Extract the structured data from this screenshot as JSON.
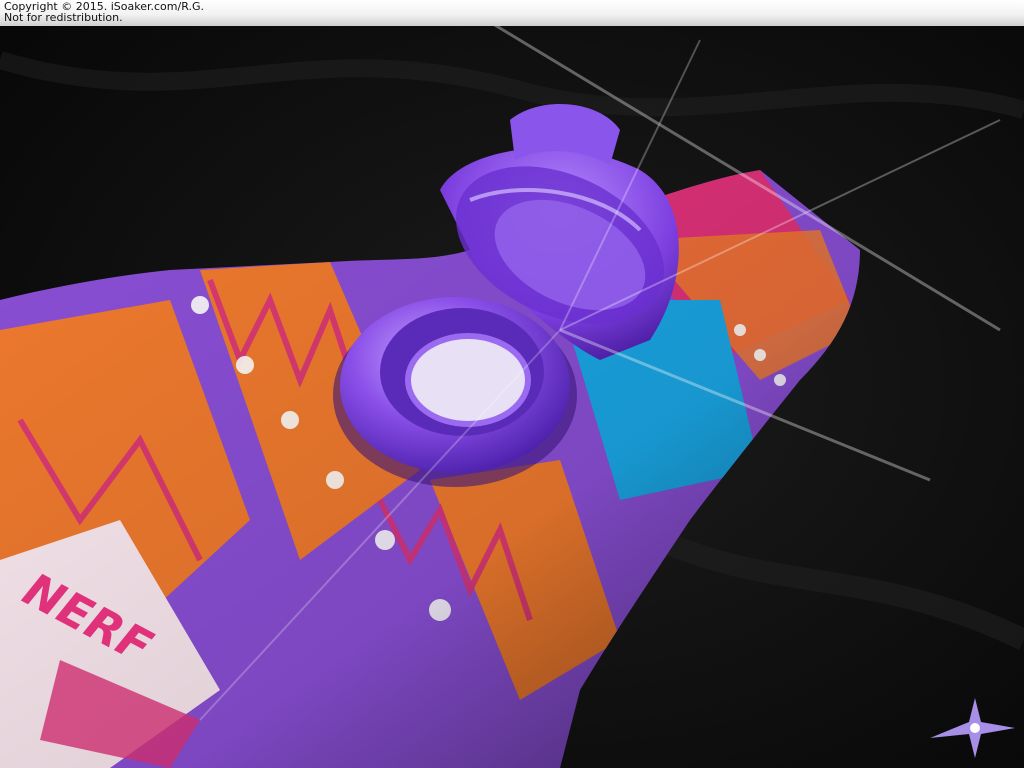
{
  "watermark": {
    "line1": "Copyright © 2015. iSoaker.com/R.G.",
    "line2": "Not for redistribution."
  },
  "photo": {
    "subject": "purple-cap-fill-port-on-printed-water-reservoir",
    "printed_logo": "NERF",
    "colors": {
      "background": "#0d0d0d",
      "purple": "#8a4fd6",
      "orange": "#f07a2e",
      "pink": "#e0327a",
      "blue": "#1aa7e6",
      "cap_purple": "#7d3fe0"
    }
  }
}
